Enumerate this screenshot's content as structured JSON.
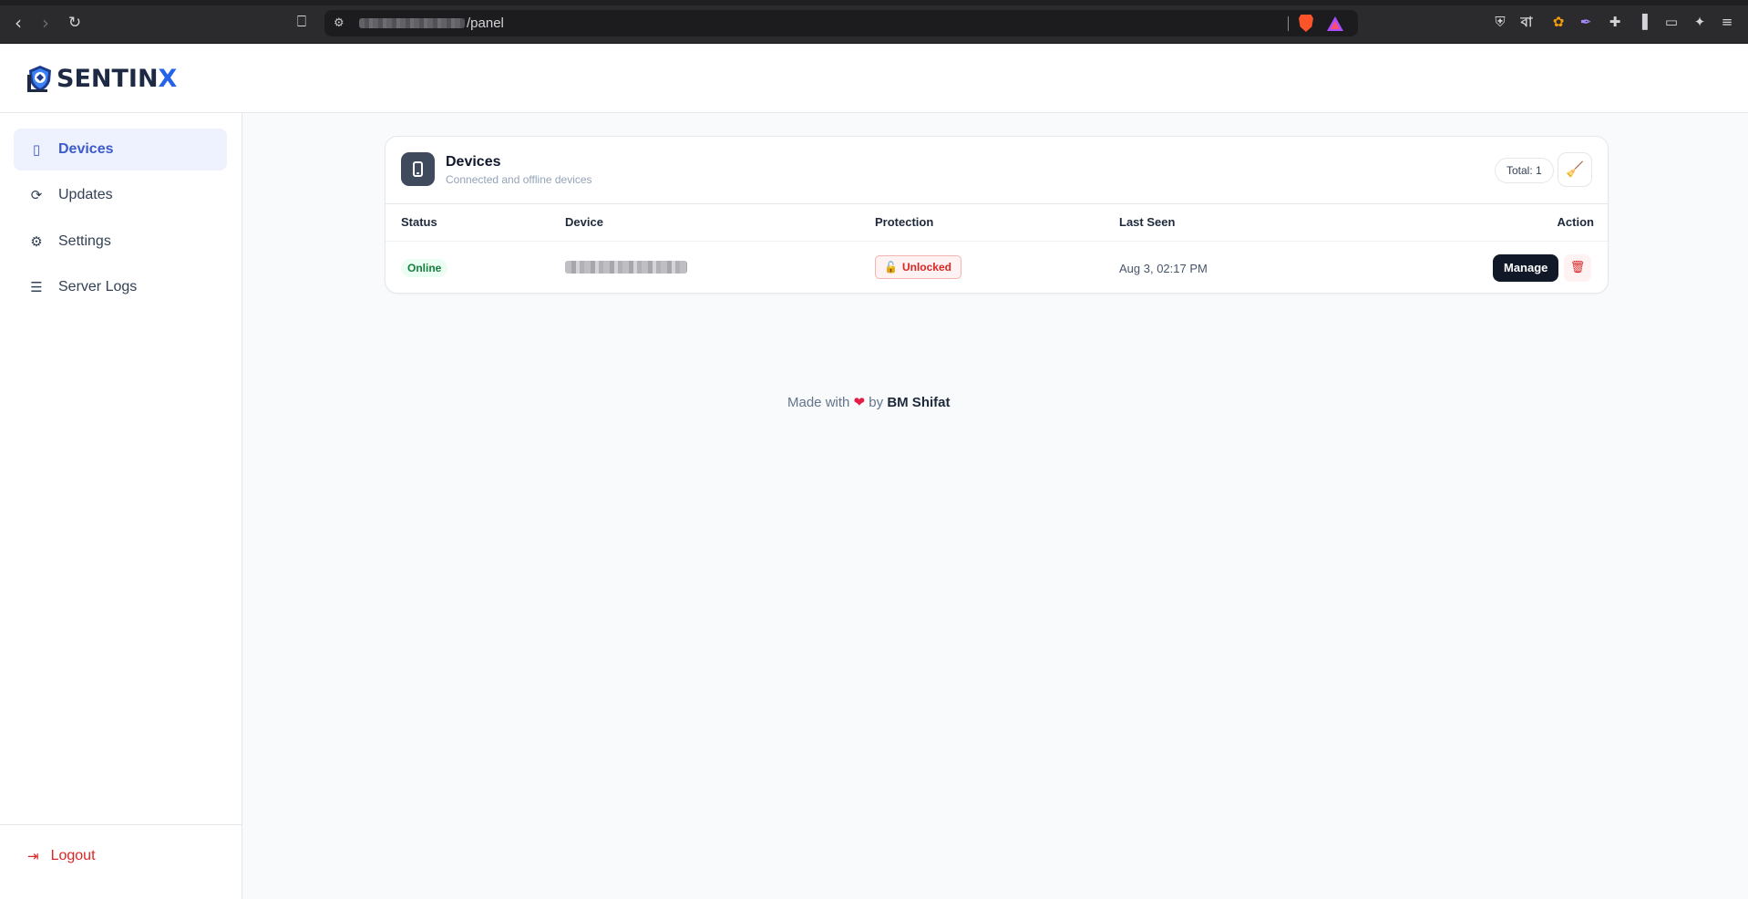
{
  "browser": {
    "url_path": "/panel",
    "nav": {
      "back_icon": "arrow-left-icon",
      "forward_icon": "arrow-right-icon",
      "reload_icon": "reload-icon"
    }
  },
  "app": {
    "logo_text": "SENTIN",
    "logo_text_accent": "X",
    "accent_color": "#2563eb"
  },
  "sidebar": {
    "items": [
      {
        "label": "Devices",
        "icon": "mobile-icon",
        "active": true
      },
      {
        "label": "Updates",
        "icon": "sync-icon",
        "active": false
      },
      {
        "label": "Settings",
        "icon": "gear-icon",
        "active": false
      },
      {
        "label": "Server Logs",
        "icon": "list-icon",
        "active": false
      }
    ],
    "logout_label": "Logout"
  },
  "devices_card": {
    "title": "Devices",
    "subtitle": "Connected and offline devices",
    "total_label": "Total: 1",
    "columns": [
      "Status",
      "Device",
      "Protection",
      "Last Seen",
      "Action"
    ],
    "rows": [
      {
        "status": "Online",
        "protection": "Unlocked",
        "last_seen": "Aug 3, 02:17 PM",
        "manage_label": "Manage"
      }
    ]
  },
  "footer": {
    "prefix": "Made with",
    "heart": "❤",
    "by": "by",
    "author": "BM Shifat"
  }
}
